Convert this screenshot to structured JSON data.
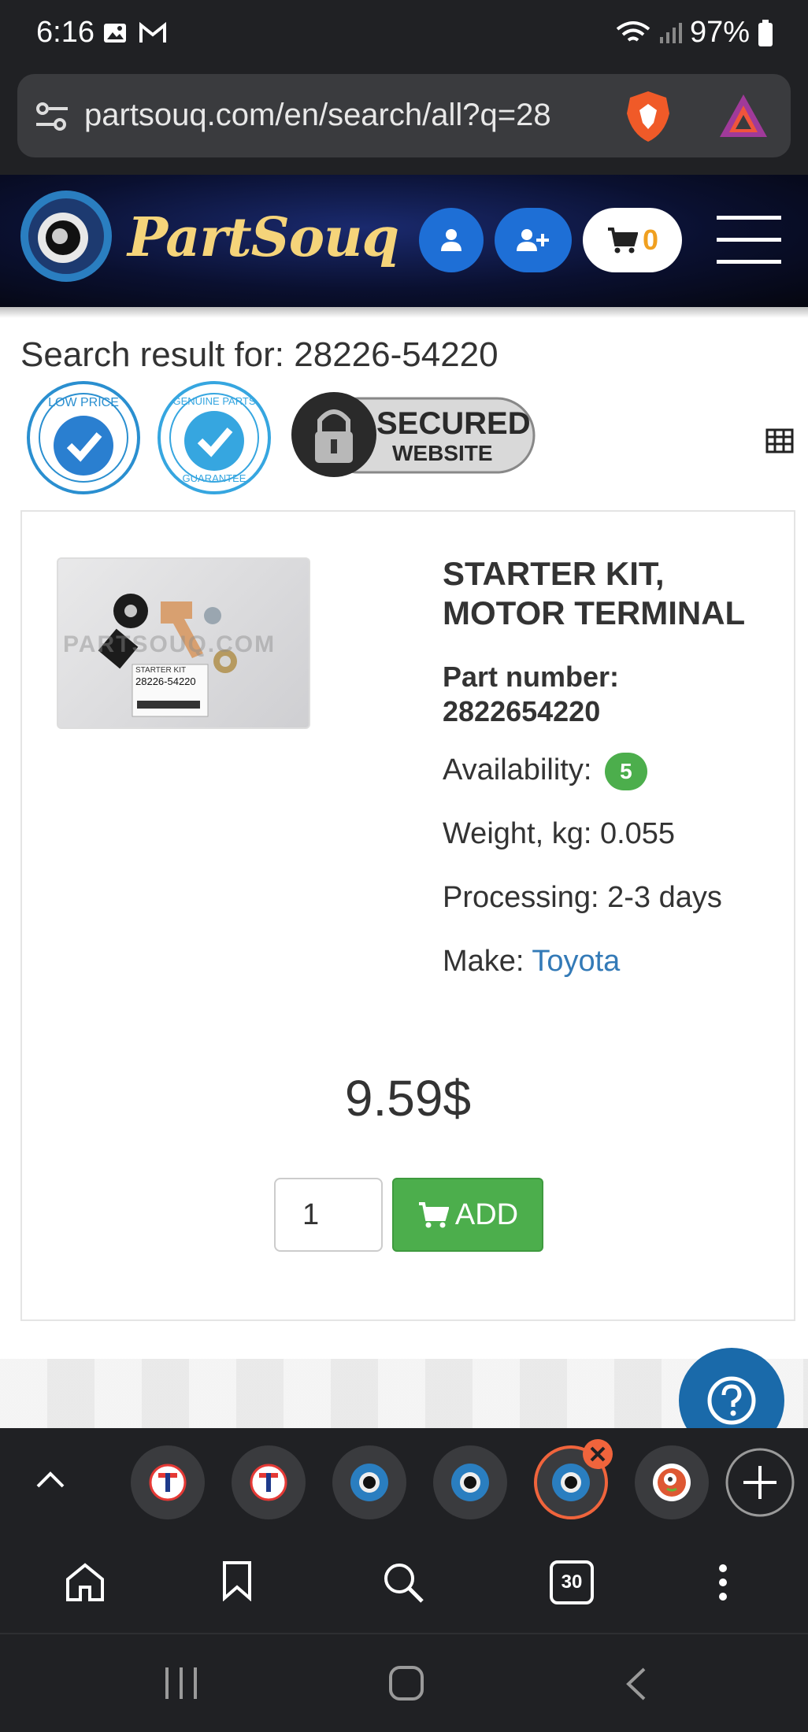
{
  "status": {
    "time": "6:16",
    "battery": "97%"
  },
  "browser": {
    "url": "partsouq.com/en/search/all?q=28",
    "tab_count": "30"
  },
  "header": {
    "brand": "PartSouq",
    "cart_count": "0"
  },
  "search": {
    "title": "Search result for: 28226-54220"
  },
  "badges": {
    "secured_line1": "SECURED",
    "secured_line2": "WEBSITE"
  },
  "product": {
    "name_line1": "STARTER KIT,",
    "name_line2": "MOTOR TERMINAL",
    "part_number_label": "Part number:",
    "part_number": "2822654220",
    "availability_label": "Availability:",
    "availability": "5",
    "weight": "Weight, kg: 0.055",
    "processing": "Processing: 2-3 days",
    "make_label": "Make:",
    "make": "Toyota",
    "price": "9.59$",
    "quantity": "1",
    "add_label": "ADD",
    "image_watermark": "PARTSOUQ.COM",
    "label_line1": "STARTER KIT",
    "label_line2": "28226-54220"
  },
  "colors": {
    "accent_blue": "#1a6aaa",
    "add_green": "#4cae4c",
    "link": "#337ab7"
  }
}
